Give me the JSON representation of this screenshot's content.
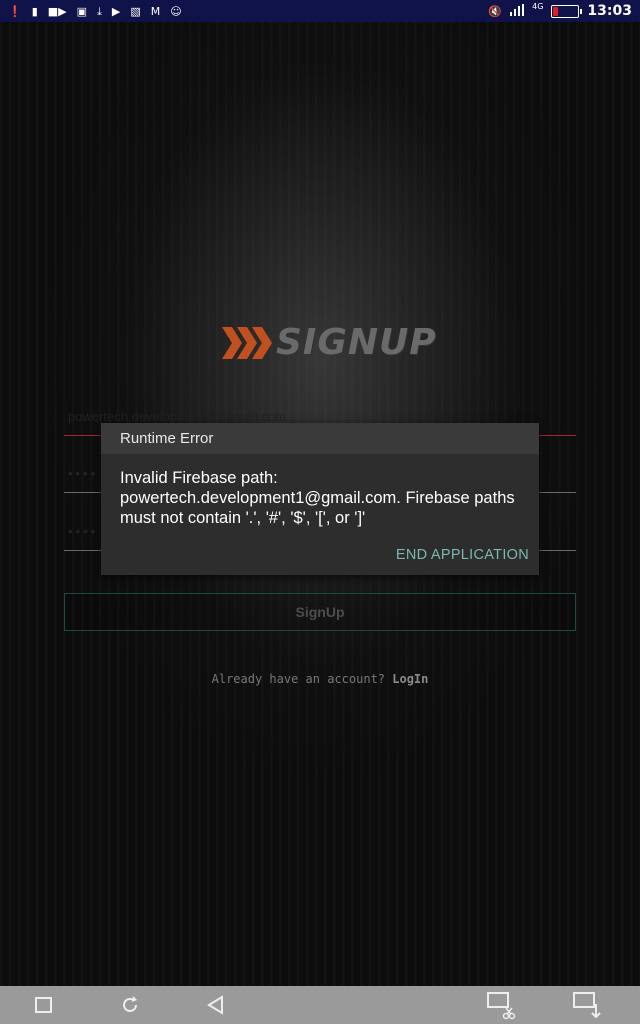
{
  "status_bar": {
    "left_icons": [
      "alert-icon",
      "sim-icon",
      "video-icon",
      "lock-icon",
      "download-icon",
      "youtube-icon",
      "image-icon",
      "gmail-icon",
      "chat-icon"
    ],
    "network": "4G",
    "time": "13:03",
    "battery_color": "#e02020"
  },
  "logo": {
    "text": "SIGNUP",
    "chevron_color": "#c1501f"
  },
  "form": {
    "email_value": "powertech.development1@gmail.com",
    "password_value": "••••",
    "confirm_password_value": "••••",
    "signup_label": "SignUp",
    "login_prompt": "Already have an account?",
    "login_link": "LogIn"
  },
  "dialog": {
    "title": "Runtime Error",
    "message": "Invalid Firebase path: powertech.development1@gmail.com. Firebase paths must not contain '.', '#', '$', '[', or ']'",
    "action": "END APPLICATION"
  },
  "nav": {
    "items": [
      "square-icon",
      "rotate-icon",
      "back-icon",
      "screenshot-scissor-icon",
      "screenshot-download-icon"
    ]
  }
}
